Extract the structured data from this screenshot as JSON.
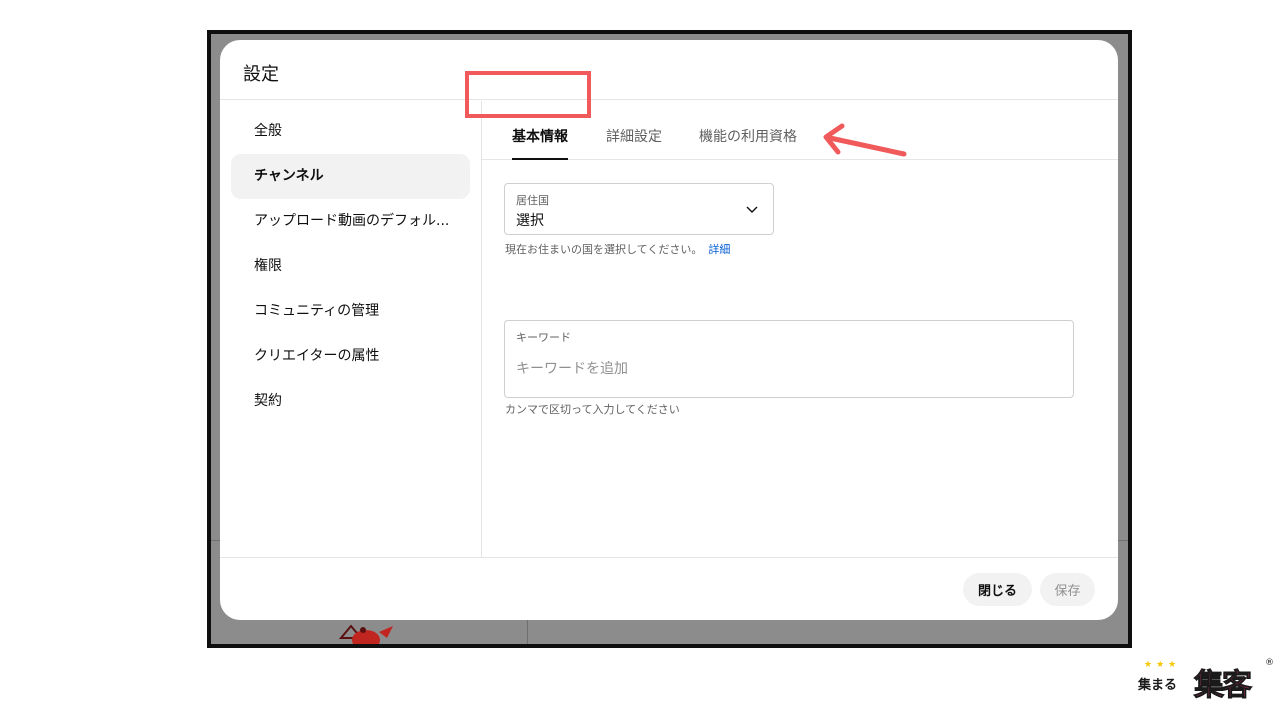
{
  "dialog": {
    "title": "設定"
  },
  "sidebar": {
    "items": [
      {
        "label": "全般"
      },
      {
        "label": "チャンネル"
      },
      {
        "label": "アップロード動画のデフォル..."
      },
      {
        "label": "権限"
      },
      {
        "label": "コミュニティの管理"
      },
      {
        "label": "クリエイターの属性"
      },
      {
        "label": "契約"
      }
    ],
    "active_index": 1
  },
  "tabs": [
    {
      "label": "基本情報"
    },
    {
      "label": "詳細設定"
    },
    {
      "label": "機能の利用資格"
    }
  ],
  "country": {
    "label": "居住国",
    "value": "選択",
    "help": "現在お住まいの国を選択してください。",
    "help_link": "詳細"
  },
  "keywords": {
    "label": "キーワード",
    "placeholder": "キーワードを追加",
    "help": "カンマで区切って入力してください"
  },
  "footer": {
    "close_label": "閉じる",
    "save_label": "保存"
  },
  "logo": {
    "small_text": "集まる",
    "big_text": "集客",
    "mark": "®"
  },
  "colors": {
    "highlight": "#f05a5a",
    "link": "#065fd4",
    "logo_pink": "#ff3b8a"
  }
}
